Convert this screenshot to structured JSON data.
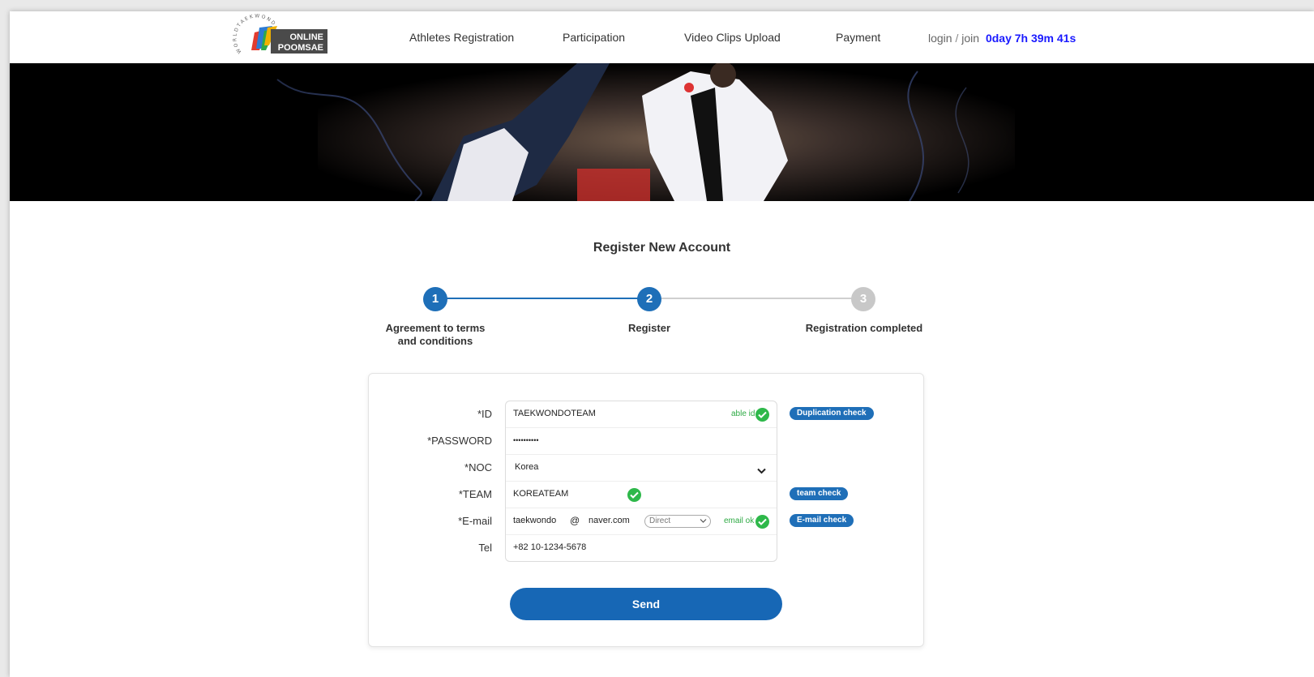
{
  "header": {
    "logo_text_line1": "ONLINE",
    "logo_text_line2": "POOMSAE",
    "logo_ring_text": "WORLD TAEKWONDO",
    "nav": [
      {
        "label": "Athletes Registration"
      },
      {
        "label": "Participation"
      },
      {
        "label": "Video Clips Upload"
      },
      {
        "label": "Payment"
      }
    ],
    "login_label": "login",
    "login_sep": " / ",
    "join_label": "join",
    "countdown": "0day 7h 39m 41s"
  },
  "page": {
    "title": "Register New Account"
  },
  "steps": [
    {
      "number": "1",
      "label_line1": "Agreement to terms",
      "label_line2": "and conditions",
      "state": "done"
    },
    {
      "number": "2",
      "label_line1": "Register",
      "label_line2": "",
      "state": "current"
    },
    {
      "number": "3",
      "label_line1": "Registration completed",
      "label_line2": "",
      "state": "pending"
    }
  ],
  "form": {
    "id": {
      "label": "*ID",
      "value": "TAEKWONDOTEAM",
      "status": "able id",
      "button": "Duplication check"
    },
    "password": {
      "label": "*PASSWORD",
      "value": "••••••••••"
    },
    "noc": {
      "label": "*NOC",
      "value": "Korea"
    },
    "team": {
      "label": "*TEAM",
      "value": "KOREATEAM",
      "button": "team check"
    },
    "email": {
      "label": "*E-mail",
      "local": "taekwondo",
      "at": "@",
      "domain": "naver.com",
      "select_value": "Direct",
      "status": "email ok",
      "button": "E-mail check"
    },
    "tel": {
      "label": "Tel",
      "value": "+82 10-1234-5678"
    },
    "send_label": "Send"
  },
  "colors": {
    "primary": "#1767b5",
    "ok": "#2eb84a",
    "countdown": "#1a1aff",
    "step_pending": "#c8c8c8"
  }
}
